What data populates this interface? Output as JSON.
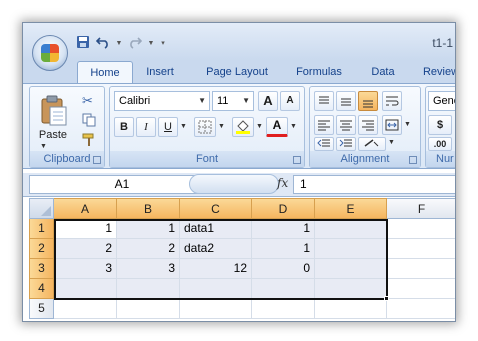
{
  "window": {
    "title": "t1-1"
  },
  "tabs": [
    "Home",
    "Insert",
    "Page Layout",
    "Formulas",
    "Data",
    "Review"
  ],
  "ribbon": {
    "clipboard": {
      "label": "Clipboard",
      "paste_label": "Paste"
    },
    "font": {
      "label": "Font",
      "font_name": "Calibri",
      "font_size": "11",
      "bold": "B",
      "italic": "I",
      "underline": "U",
      "grow": "A",
      "shrink": "A",
      "font_color_letter": "A"
    },
    "alignment": {
      "label": "Alignment"
    },
    "number": {
      "label": "Nur",
      "format": "Gene",
      "currency": "$",
      "decimals": ".00"
    }
  },
  "formula_bar": {
    "name_box": "A1",
    "fx": "fx",
    "formula": "1"
  },
  "grid": {
    "columns": [
      "A",
      "B",
      "C",
      "D",
      "E",
      "F"
    ],
    "rows": [
      "1",
      "2",
      "3",
      "4",
      "5"
    ],
    "cells": [
      [
        "1",
        "1",
        "data1",
        "1",
        "",
        ""
      ],
      [
        "2",
        "2",
        "data2",
        "1",
        "",
        ""
      ],
      [
        "3",
        "3",
        "12",
        "0",
        "",
        ""
      ],
      [
        "",
        "",
        "",
        "",
        "",
        ""
      ],
      [
        "",
        "",
        "",
        "",
        "",
        ""
      ]
    ]
  },
  "colors": {
    "selection_header": "#f8c878",
    "ribbon": "#dbe7f6",
    "tab_text": "#15428b"
  }
}
